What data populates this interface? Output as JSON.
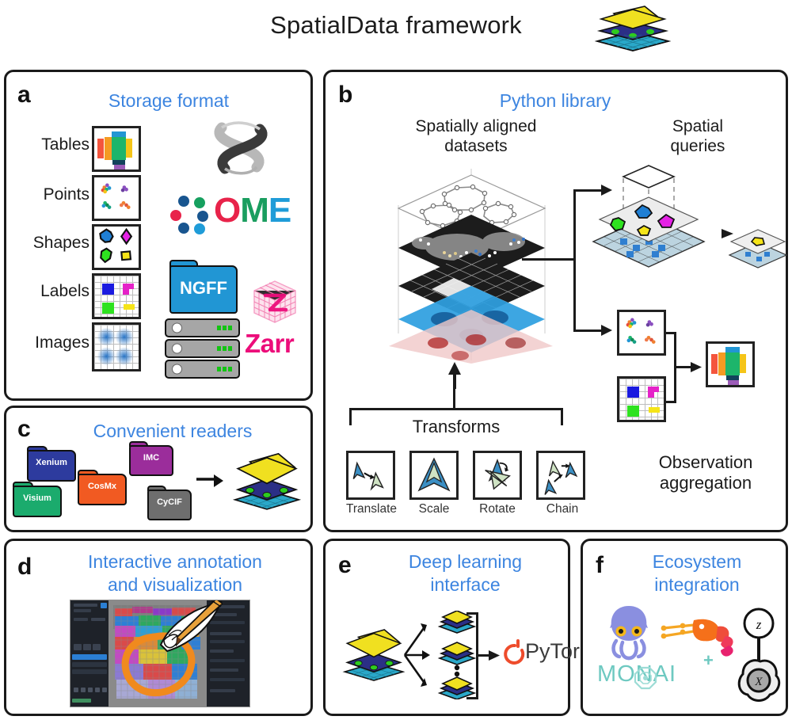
{
  "figure": {
    "title": "SpatialData framework",
    "logo_name": "spatialdata-logo"
  },
  "panels": {
    "a": {
      "letter": "a",
      "heading": "Storage format",
      "rows": [
        {
          "label": "Tables",
          "icon": "tables-thumbnail"
        },
        {
          "label": "Points",
          "icon": "points-thumbnail"
        },
        {
          "label": "Shapes",
          "icon": "shapes-thumbnail"
        },
        {
          "label": "Labels",
          "icon": "labels-thumbnail"
        },
        {
          "label": "Images",
          "icon": "images-thumbnail"
        }
      ],
      "logos": {
        "anndata": "anndata-ribbon-logo",
        "ome_text": "OME",
        "ome_dots": "ome-dots-icon",
        "ngff_folder": "NGFF",
        "zarr_text": "Zarr",
        "server": "server-stack-icon"
      }
    },
    "b": {
      "letter": "b",
      "heading": "Python library",
      "aligned_datasets_label": "Spatially aligned\ndatasets",
      "aligned_datasets_line1": "Spatially aligned",
      "aligned_datasets_line2": "datasets",
      "spatial_queries_line1": "Spatial",
      "spatial_queries_line2": "queries",
      "observation_line1": "Observation",
      "observation_line2": "aggregation",
      "transforms_label": "Transforms",
      "transforms": [
        {
          "label": "Translate",
          "icon": "translate-icon"
        },
        {
          "label": "Scale",
          "icon": "scale-icon"
        },
        {
          "label": "Rotate",
          "icon": "rotate-icon"
        },
        {
          "label": "Chain",
          "icon": "chain-icon"
        }
      ]
    },
    "c": {
      "letter": "c",
      "heading": "Convenient readers",
      "readers": [
        {
          "label": "Xenium",
          "color": "#2d3b9e"
        },
        {
          "label": "Visium",
          "color": "#1bab6d"
        },
        {
          "label": "CosMx",
          "color": "#f15a22"
        },
        {
          "label": "IMC",
          "color": "#9b2d9b"
        },
        {
          "label": "CyCIF",
          "color": "#6e6e6e"
        }
      ],
      "arrow": "arrow-right-icon",
      "result": "spatialdata-logo"
    },
    "d": {
      "letter": "d",
      "heading_line1": "Interactive annotation",
      "heading_line2": "and visualization",
      "screenshot": "napari-annotation-screenshot"
    },
    "e": {
      "letter": "e",
      "heading_line1": "Deep learning",
      "heading_line2": "interface",
      "pytorch_label": "PyTorch",
      "source": "spatialdata-logo",
      "tiles": "dataset-tiles"
    },
    "f": {
      "letter": "f",
      "heading_line1": "Ecosystem",
      "heading_line2": "integration",
      "logos": {
        "squidpy": "squidpy-squid-icon",
        "scanpy": "scanpy-shrimp-icon",
        "monai": "MONAI",
        "monai_plus": "+",
        "anndata_cell": "anndata-cell-icon",
        "anndata_z": "z",
        "anndata_x": "X"
      }
    }
  },
  "colors": {
    "heading_blue": "#3d85e0",
    "zarr_pink": "#ec0d7a",
    "ngff_blue": "#2196d4",
    "ome_red": "#e8234a",
    "ome_green": "#1a9e5f",
    "ome_blue": "#1f9cd8",
    "logo_yellow": "#f0e020",
    "logo_navy": "#2b2f86",
    "logo_teal": "#2aa8c9",
    "logo_green": "#2ecc1f",
    "annotation_orange": "#f08a1e",
    "pytorch_red": "#ee4c2c"
  }
}
